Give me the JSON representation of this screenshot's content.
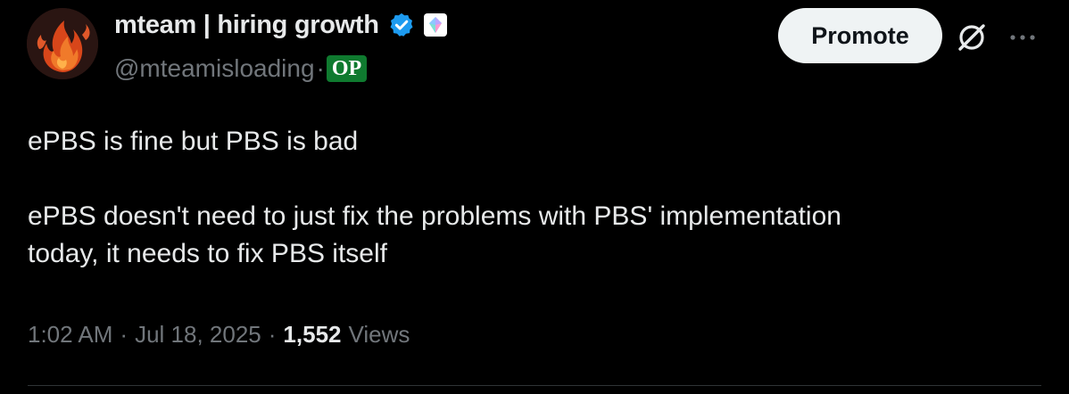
{
  "user": {
    "display_name": "mteam | hiring growth",
    "handle": "@mteamisloading",
    "separator": "·",
    "op_badge": "OP"
  },
  "actions": {
    "promote_label": "Promote"
  },
  "tweet": {
    "paragraph_1": "ePBS is fine but PBS is bad",
    "paragraph_2_line_1": "ePBS doesn't need to just fix the problems with PBS' implementation",
    "paragraph_2_line_2": "today, it needs to fix PBS itself"
  },
  "meta": {
    "time": "1:02 AM",
    "separator": "·",
    "date": "Jul 18, 2025",
    "views_count": "1,552",
    "views_label": "Views"
  },
  "colors": {
    "background": "#000000",
    "text": "#e7e9ea",
    "muted": "#71767b",
    "verified": "#1d9bf0",
    "op_badge": "#0f7a2f",
    "promote_bg": "#eff3f4"
  }
}
